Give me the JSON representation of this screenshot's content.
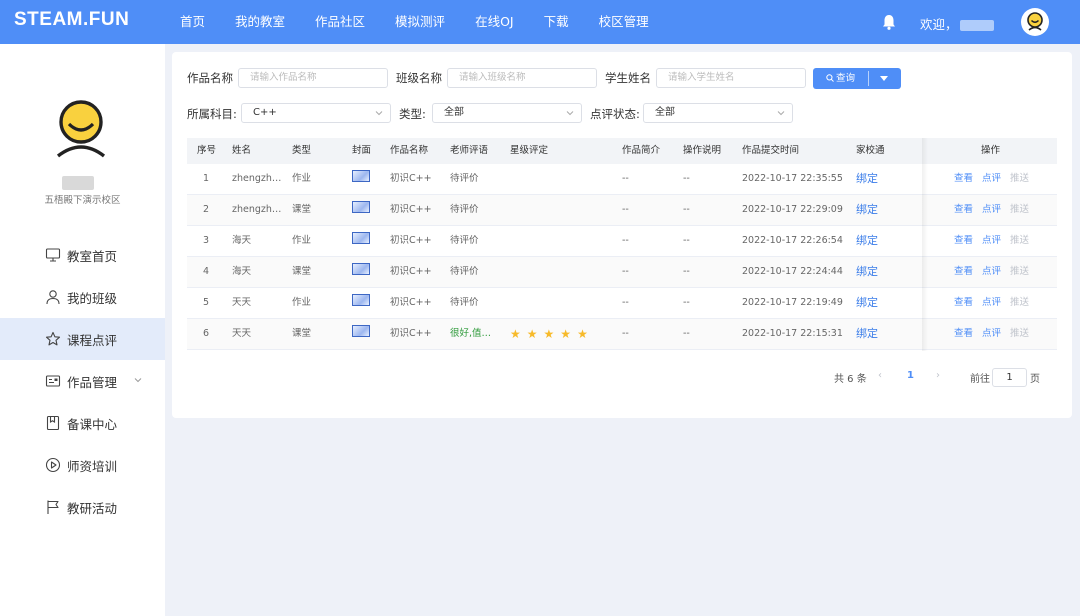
{
  "app": {
    "logo": "STEAM.FUN"
  },
  "nav": [
    "首页",
    "我的教室",
    "作品社区",
    "模拟测评",
    "在线OJ",
    "下载",
    "校区管理"
  ],
  "header": {
    "welcome": "欢迎，"
  },
  "sidebar": {
    "school": "五梧殿下演示校区",
    "items": [
      {
        "label": "教室首页",
        "icon": "monitor-icon"
      },
      {
        "label": "我的班级",
        "icon": "user-icon"
      },
      {
        "label": "课程点评",
        "icon": "star-icon",
        "active": true
      },
      {
        "label": "作品管理",
        "icon": "id-card-icon",
        "expandable": true
      },
      {
        "label": "备课中心",
        "icon": "book-icon"
      },
      {
        "label": "师资培训",
        "icon": "play-circle-icon"
      },
      {
        "label": "教研活动",
        "icon": "flag-icon"
      }
    ]
  },
  "filters": {
    "work_name": {
      "label": "作品名称",
      "placeholder": "请输入作品名称"
    },
    "class_name": {
      "label": "班级名称",
      "placeholder": "请输入班级名称"
    },
    "student_name": {
      "label": "学生姓名",
      "placeholder": "请输入学生姓名"
    },
    "subject": {
      "label": "所属科目:",
      "value": "C++"
    },
    "type": {
      "label": "类型:",
      "value": "全部"
    },
    "review_status": {
      "label": "点评状态:",
      "value": "全部"
    },
    "query_button": "查询"
  },
  "table": {
    "headers": [
      "序号",
      "姓名",
      "类型",
      "封面",
      "作品名称",
      "老师评语",
      "星级评定",
      "作品简介",
      "操作说明",
      "作品提交时间",
      "家校通",
      "操作"
    ],
    "rows": [
      {
        "no": "1",
        "name": "zhengzh…",
        "type": "作业",
        "work": "初识C++",
        "comment": "待评价",
        "stars": 0,
        "intro": "--",
        "instr": "--",
        "time": "2022-10-17 22:35:55",
        "link": "绑定"
      },
      {
        "no": "2",
        "name": "zhengzh…",
        "type": "课堂",
        "work": "初识C++",
        "comment": "待评价",
        "stars": 0,
        "intro": "--",
        "instr": "--",
        "time": "2022-10-17 22:29:09",
        "link": "绑定"
      },
      {
        "no": "3",
        "name": "海天",
        "type": "作业",
        "work": "初识C++",
        "comment": "待评价",
        "stars": 0,
        "intro": "--",
        "instr": "--",
        "time": "2022-10-17 22:26:54",
        "link": "绑定"
      },
      {
        "no": "4",
        "name": "海天",
        "type": "课堂",
        "work": "初识C++",
        "comment": "待评价",
        "stars": 0,
        "intro": "--",
        "instr": "--",
        "time": "2022-10-17 22:24:44",
        "link": "绑定"
      },
      {
        "no": "5",
        "name": "天天",
        "type": "作业",
        "work": "初识C++",
        "comment": "待评价",
        "stars": 0,
        "intro": "--",
        "instr": "--",
        "time": "2022-10-17 22:19:49",
        "link": "绑定"
      },
      {
        "no": "6",
        "name": "天天",
        "type": "课堂",
        "work": "初识C++",
        "comment": "很好,值…",
        "stars": 5,
        "intro": "--",
        "instr": "--",
        "time": "2022-10-17 22:15:31",
        "link": "绑定"
      }
    ],
    "actions": {
      "view": "查看",
      "review": "点评",
      "push": "推送"
    }
  },
  "pagination": {
    "total": "共 6 条",
    "current": "1",
    "goto_label": "前往",
    "goto_value": "1",
    "page_unit": "页"
  },
  "colors": {
    "primary": "#4f8ef7",
    "active_bg": "#e3ebfa",
    "star": "#f7ba2a",
    "good": "#2e9a3a"
  }
}
